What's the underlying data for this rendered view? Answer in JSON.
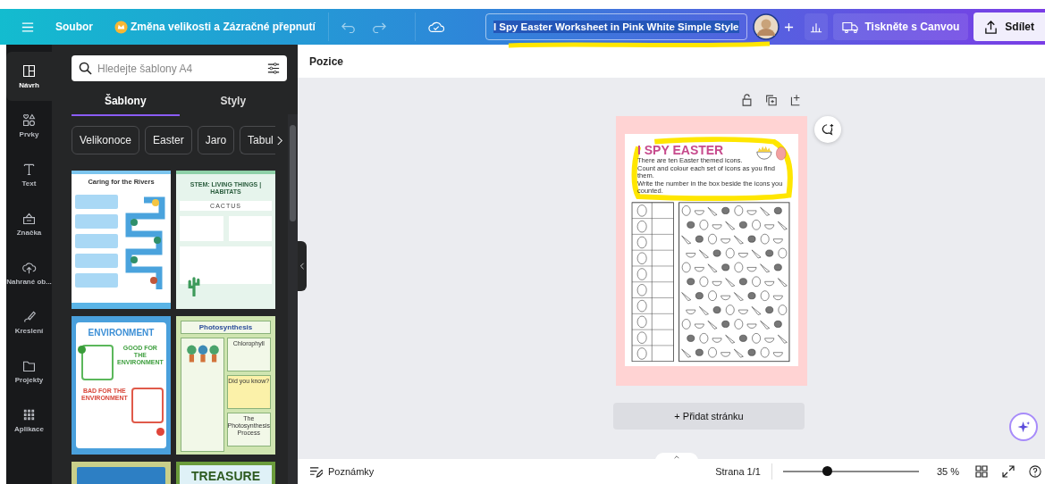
{
  "topbar": {
    "file_menu": "Soubor",
    "promo": "Změna velikosti a Zázračné přepnutí",
    "document_title": "I Spy Easter Worksheet in Pink White Simple Style",
    "title_text_selected": true,
    "print_button": "Tiskněte s Canvou",
    "share_button": "Sdílet"
  },
  "rail": {
    "items": [
      {
        "label": "Návrh",
        "selected": true
      },
      {
        "label": "Prvky",
        "selected": false
      },
      {
        "label": "Text",
        "selected": false
      },
      {
        "label": "Značka",
        "selected": false
      },
      {
        "label": "Nahrané ob...",
        "selected": false
      },
      {
        "label": "Kreslení",
        "selected": false
      },
      {
        "label": "Projekty",
        "selected": false
      },
      {
        "label": "Aplikace",
        "selected": false
      }
    ]
  },
  "panel": {
    "search_placeholder": "Hledejte šablony A4",
    "tabs": [
      {
        "label": "Šablony",
        "selected": true
      },
      {
        "label": "Styly",
        "selected": false
      }
    ],
    "chips": [
      "Velikonoce",
      "Easter",
      "Jaro",
      "Tabul"
    ],
    "templates": [
      {
        "kind": "rivers",
        "title": "Caring for the Rivers"
      },
      {
        "kind": "habitats",
        "title": "STEM: LIVING THINGS | HABITATS",
        "texts": [
          "CACTUS"
        ]
      },
      {
        "kind": "environment",
        "title": "ENVIRONMENT",
        "texts": [
          "GOOD FOR THE ENVIRONMENT",
          "BAD FOR THE ENVIRONMENT"
        ]
      },
      {
        "kind": "photosynthesis",
        "title": "Photosynthesis",
        "texts": [
          "Chlorophyll",
          "Did you know?",
          "The Photosynthesis Process"
        ]
      },
      {
        "kind": "map"
      },
      {
        "kind": "treasure",
        "title": "TREASURE"
      }
    ]
  },
  "canvas": {
    "toolbar_label": "Pozice",
    "page": {
      "title": "I SPY EASTER",
      "instructions": [
        "There are ten Easter themed icons.",
        "Count and colour each set of icons as you find them.",
        "Write the number in the box beside the icons you counted."
      ]
    },
    "add_page_button": "+ Přidat stránku"
  },
  "bottom_bar": {
    "notes": "Poznámky",
    "page_indicator": "Strana 1/1",
    "zoom": {
      "level": 0.32
    },
    "zoom_reading": "35 %"
  }
}
